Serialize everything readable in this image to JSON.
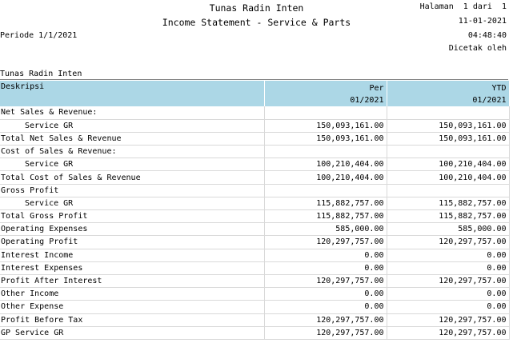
{
  "header": {
    "company": "Tunas Radin Inten",
    "report_title": "Income Statement - Service & Parts",
    "page_info": "Halaman  1 dari  1",
    "print_date": "11-01-2021",
    "print_time": "04:48:40",
    "printed_by": "Dicetak oleh",
    "period": "Periode 1/1/2021",
    "company_sub": "Tunas Radin Inten"
  },
  "table": {
    "columns": {
      "description": "Deskripsi",
      "per_line1": "Per",
      "per_line2": "01/2021",
      "ytd_line1": "YTD",
      "ytd_line2": "01/2021"
    },
    "rows": [
      {
        "label": "Net Sales & Revenue:",
        "per": "",
        "ytd": "",
        "indent": false
      },
      {
        "label": "Service GR",
        "per": "150,093,161.00",
        "ytd": "150,093,161.00",
        "indent": true
      },
      {
        "label": "Total Net Sales & Revenue",
        "per": "150,093,161.00",
        "ytd": "150,093,161.00",
        "indent": false
      },
      {
        "label": "Cost of Sales & Revenue:",
        "per": "",
        "ytd": "",
        "indent": false
      },
      {
        "label": "Service GR",
        "per": "100,210,404.00",
        "ytd": "100,210,404.00",
        "indent": true
      },
      {
        "label": "Total Cost of Sales & Revenue",
        "per": "100,210,404.00",
        "ytd": "100,210,404.00",
        "indent": false
      },
      {
        "label": "Gross Profit",
        "per": "",
        "ytd": "",
        "indent": false
      },
      {
        "label": "Service GR",
        "per": "115,882,757.00",
        "ytd": "115,882,757.00",
        "indent": true
      },
      {
        "label": "Total Gross Profit",
        "per": "115,882,757.00",
        "ytd": "115,882,757.00",
        "indent": false
      },
      {
        "label": "Operating Expenses",
        "per": "585,000.00",
        "ytd": "585,000.00",
        "indent": false
      },
      {
        "label": "Operating Profit",
        "per": "120,297,757.00",
        "ytd": "120,297,757.00",
        "indent": false
      },
      {
        "label": "Interest Income",
        "per": "0.00",
        "ytd": "0.00",
        "indent": false
      },
      {
        "label": "Interest Expenses",
        "per": "0.00",
        "ytd": "0.00",
        "indent": false
      },
      {
        "label": "Profit After Interest",
        "per": "120,297,757.00",
        "ytd": "120,297,757.00",
        "indent": false
      },
      {
        "label": "Other Income",
        "per": "0.00",
        "ytd": "0.00",
        "indent": false
      },
      {
        "label": "Other Expense",
        "per": "0.00",
        "ytd": "0.00",
        "indent": false
      },
      {
        "label": "Profit Before Tax",
        "per": "120,297,757.00",
        "ytd": "120,297,757.00",
        "indent": false
      },
      {
        "label": "GP Service GR",
        "per": "120,297,757.00",
        "ytd": "120,297,757.00",
        "indent": false
      }
    ]
  }
}
